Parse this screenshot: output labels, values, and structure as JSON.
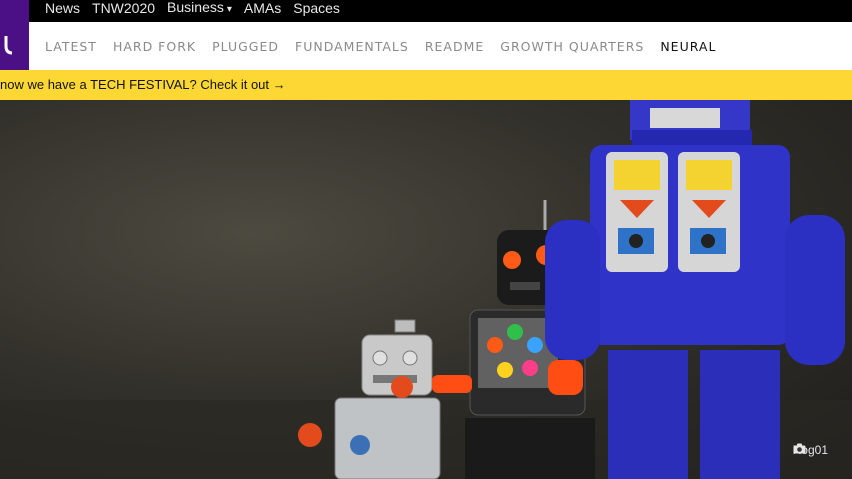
{
  "top_nav": {
    "items": [
      {
        "label": "News"
      },
      {
        "label": "TNW2020"
      },
      {
        "label": "Business",
        "has_dropdown": true
      },
      {
        "label": "AMAs"
      },
      {
        "label": "Spaces"
      }
    ],
    "dropdown_glyph": "▾"
  },
  "section_nav": {
    "items": [
      {
        "label": "LATEST"
      },
      {
        "label": "HARD FORK"
      },
      {
        "label": "PLUGGED"
      },
      {
        "label": "FUNDAMENTALS"
      },
      {
        "label": "README"
      },
      {
        "label": "GROWTH QUARTERS"
      },
      {
        "label": "NEURAL",
        "active": true
      }
    ]
  },
  "promo": {
    "text": "now we have a TECH FESTIVAL? Check it out →"
  },
  "hero": {
    "photo_credit": "Rog01",
    "credit_icon": "camera-icon"
  },
  "colors": {
    "brand_purple": "#4b0f86",
    "promo_yellow": "#fdd835",
    "topbar_bg": "#000000"
  }
}
